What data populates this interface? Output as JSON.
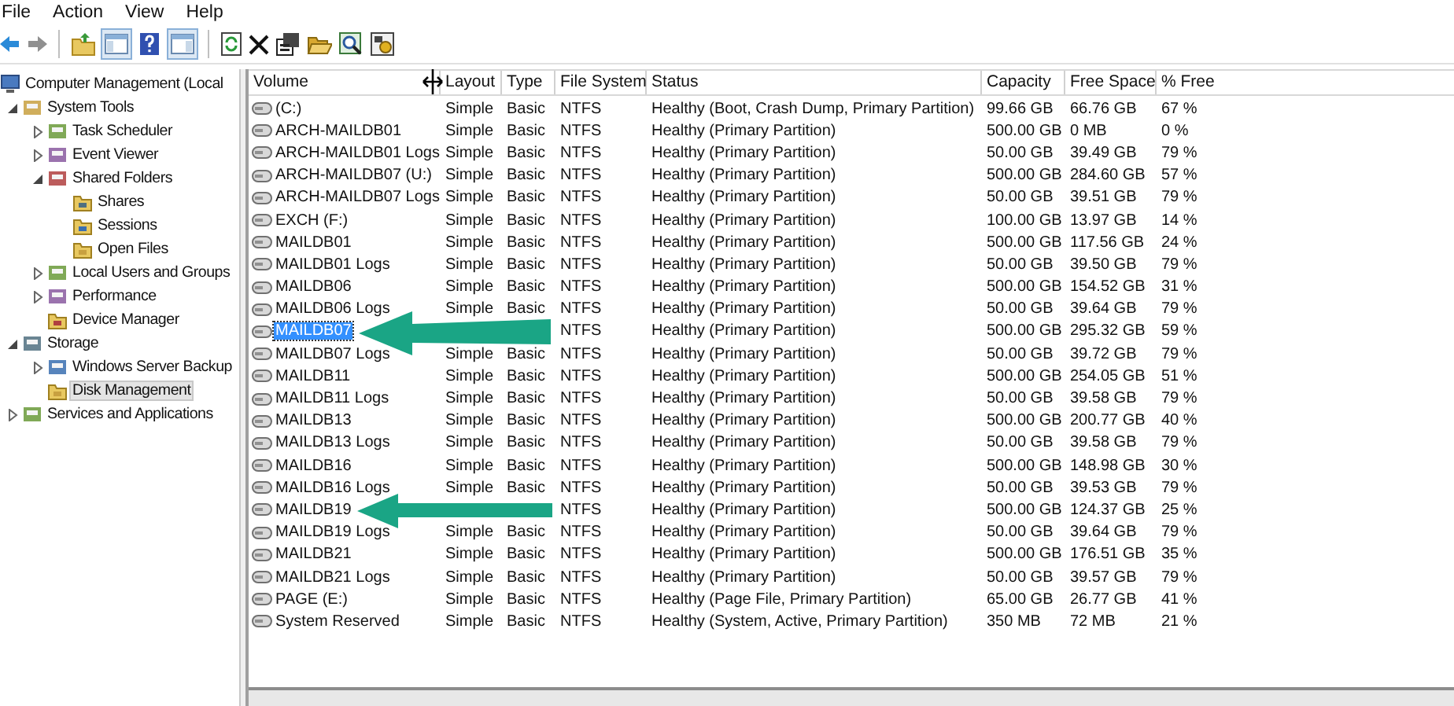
{
  "menu": [
    "File",
    "Action",
    "View",
    "Help"
  ],
  "tree": [
    {
      "label": "Computer Management (Local",
      "kind": "root",
      "selected": false,
      "children": [
        {
          "label": "System Tools",
          "kind": "branch",
          "expanded": true,
          "selected": false,
          "children": [
            {
              "label": "Task Scheduler",
              "kind": "branch",
              "expanded": false,
              "selected": false
            },
            {
              "label": "Event Viewer",
              "kind": "branch",
              "expanded": false,
              "selected": false
            },
            {
              "label": "Shared Folders",
              "kind": "branch",
              "expanded": true,
              "selected": false,
              "children": [
                {
                  "label": "Shares",
                  "kind": "leaf",
                  "selected": false
                },
                {
                  "label": "Sessions",
                  "kind": "leaf",
                  "selected": false
                },
                {
                  "label": "Open Files",
                  "kind": "leaf",
                  "selected": false
                }
              ]
            },
            {
              "label": "Local Users and Groups",
              "kind": "branch",
              "expanded": false,
              "selected": false
            },
            {
              "label": "Performance",
              "kind": "branch",
              "expanded": false,
              "selected": false
            },
            {
              "label": "Device Manager",
              "kind": "leaf",
              "selected": false
            }
          ]
        },
        {
          "label": "Storage",
          "kind": "branch",
          "expanded": true,
          "selected": false,
          "children": [
            {
              "label": "Windows Server Backup",
              "kind": "branch",
              "expanded": false,
              "selected": false
            },
            {
              "label": "Disk Management",
              "kind": "leaf",
              "selected": true
            }
          ]
        },
        {
          "label": "Services and Applications",
          "kind": "branch",
          "expanded": false,
          "selected": false
        }
      ]
    }
  ],
  "table": {
    "columns": [
      "Volume",
      "Layout",
      "Type",
      "File System",
      "Status",
      "Capacity",
      "Free Space",
      "% Free"
    ],
    "rows": [
      {
        "volume": "(C:)",
        "layout": "Simple",
        "type": "Basic",
        "file_system": "NTFS",
        "status": "Healthy (Boot, Crash Dump, Primary Partition)",
        "capacity": "99.66 GB",
        "free_space": "66.76 GB",
        "percent_free": "67 %",
        "selected": false
      },
      {
        "volume": "ARCH-MAILDB01",
        "layout": "Simple",
        "type": "Basic",
        "file_system": "NTFS",
        "status": "Healthy (Primary Partition)",
        "capacity": "500.00 GB",
        "free_space": "0 MB",
        "percent_free": "0 %",
        "selected": false
      },
      {
        "volume": "ARCH-MAILDB01 Logs",
        "layout": "Simple",
        "type": "Basic",
        "file_system": "NTFS",
        "status": "Healthy (Primary Partition)",
        "capacity": "50.00 GB",
        "free_space": "39.49 GB",
        "percent_free": "79 %",
        "selected": false
      },
      {
        "volume": "ARCH-MAILDB07 (U:)",
        "layout": "Simple",
        "type": "Basic",
        "file_system": "NTFS",
        "status": "Healthy (Primary Partition)",
        "capacity": "500.00 GB",
        "free_space": "284.60 GB",
        "percent_free": "57 %",
        "selected": false
      },
      {
        "volume": "ARCH-MAILDB07 Logs",
        "layout": "Simple",
        "type": "Basic",
        "file_system": "NTFS",
        "status": "Healthy (Primary Partition)",
        "capacity": "50.00 GB",
        "free_space": "39.51 GB",
        "percent_free": "79 %",
        "selected": false
      },
      {
        "volume": "EXCH (F:)",
        "layout": "Simple",
        "type": "Basic",
        "file_system": "NTFS",
        "status": "Healthy (Primary Partition)",
        "capacity": "100.00 GB",
        "free_space": "13.97 GB",
        "percent_free": "14 %",
        "selected": false
      },
      {
        "volume": "MAILDB01",
        "layout": "Simple",
        "type": "Basic",
        "file_system": "NTFS",
        "status": "Healthy (Primary Partition)",
        "capacity": "500.00 GB",
        "free_space": "117.56 GB",
        "percent_free": "24 %",
        "selected": false
      },
      {
        "volume": "MAILDB01 Logs",
        "layout": "Simple",
        "type": "Basic",
        "file_system": "NTFS",
        "status": "Healthy (Primary Partition)",
        "capacity": "50.00 GB",
        "free_space": "39.50 GB",
        "percent_free": "79 %",
        "selected": false
      },
      {
        "volume": "MAILDB06",
        "layout": "Simple",
        "type": "Basic",
        "file_system": "NTFS",
        "status": "Healthy (Primary Partition)",
        "capacity": "500.00 GB",
        "free_space": "154.52 GB",
        "percent_free": "31 %",
        "selected": false
      },
      {
        "volume": "MAILDB06 Logs",
        "layout": "Simple",
        "type": "Basic",
        "file_system": "NTFS",
        "status": "Healthy (Primary Partition)",
        "capacity": "50.00 GB",
        "free_space": "39.64 GB",
        "percent_free": "79 %",
        "selected": false
      },
      {
        "volume": "MAILDB07",
        "file_system": "NTFS",
        "status": "Healthy (Primary Partition)",
        "capacity": "500.00 GB",
        "free_space": "295.32 GB",
        "percent_free": "59 %",
        "selected": true
      },
      {
        "volume": "MAILDB07 Logs",
        "layout": "Simple",
        "type": "Basic",
        "file_system": "NTFS",
        "status": "Healthy (Primary Partition)",
        "capacity": "50.00 GB",
        "free_space": "39.72 GB",
        "percent_free": "79 %",
        "selected": false
      },
      {
        "volume": "MAILDB11",
        "layout": "Simple",
        "type": "Basic",
        "file_system": "NTFS",
        "status": "Healthy (Primary Partition)",
        "capacity": "500.00 GB",
        "free_space": "254.05 GB",
        "percent_free": "51 %",
        "selected": false
      },
      {
        "volume": "MAILDB11 Logs",
        "layout": "Simple",
        "type": "Basic",
        "file_system": "NTFS",
        "status": "Healthy (Primary Partition)",
        "capacity": "50.00 GB",
        "free_space": "39.58 GB",
        "percent_free": "79 %",
        "selected": false
      },
      {
        "volume": "MAILDB13",
        "layout": "Simple",
        "type": "Basic",
        "file_system": "NTFS",
        "status": "Healthy (Primary Partition)",
        "capacity": "500.00 GB",
        "free_space": "200.77 GB",
        "percent_free": "40 %",
        "selected": false
      },
      {
        "volume": "MAILDB13 Logs",
        "layout": "Simple",
        "type": "Basic",
        "file_system": "NTFS",
        "status": "Healthy (Primary Partition)",
        "capacity": "50.00 GB",
        "free_space": "39.58 GB",
        "percent_free": "79 %",
        "selected": false
      },
      {
        "volume": "MAILDB16",
        "layout": "Simple",
        "type": "Basic",
        "file_system": "NTFS",
        "status": "Healthy (Primary Partition)",
        "capacity": "500.00 GB",
        "free_space": "148.98 GB",
        "percent_free": "30 %",
        "selected": false
      },
      {
        "volume": "MAILDB16 Logs",
        "layout": "Simple",
        "type": "Basic",
        "file_system": "NTFS",
        "status": "Healthy (Primary Partition)",
        "capacity": "50.00 GB",
        "free_space": "39.53 GB",
        "percent_free": "79 %",
        "selected": false
      },
      {
        "volume": "MAILDB19",
        "file_system": "NTFS",
        "status": "Healthy (Primary Partition)",
        "capacity": "500.00 GB",
        "free_space": "124.37 GB",
        "percent_free": "25 %",
        "selected": false
      },
      {
        "volume": "MAILDB19 Logs",
        "layout": "Simple",
        "type": "Basic",
        "file_system": "NTFS",
        "status": "Healthy (Primary Partition)",
        "capacity": "50.00 GB",
        "free_space": "39.64 GB",
        "percent_free": "79 %",
        "selected": false
      },
      {
        "volume": "MAILDB21",
        "layout": "Simple",
        "type": "Basic",
        "file_system": "NTFS",
        "status": "Healthy (Primary Partition)",
        "capacity": "500.00 GB",
        "free_space": "176.51 GB",
        "percent_free": "35 %",
        "selected": false
      },
      {
        "volume": "MAILDB21 Logs",
        "layout": "Simple",
        "type": "Basic",
        "file_system": "NTFS",
        "status": "Healthy (Primary Partition)",
        "capacity": "50.00 GB",
        "free_space": "39.57 GB",
        "percent_free": "79 %",
        "selected": false
      },
      {
        "volume": "PAGE (E:)",
        "layout": "Simple",
        "type": "Basic",
        "file_system": "NTFS",
        "status": "Healthy (Page File, Primary Partition)",
        "capacity": "65.00 GB",
        "free_space": "26.77 GB",
        "percent_free": "41 %",
        "selected": false
      },
      {
        "volume": "System Reserved",
        "layout": "Simple",
        "type": "Basic",
        "file_system": "NTFS",
        "status": "Healthy (System, Active, Primary Partition)",
        "capacity": "350 MB",
        "free_space": "72 MB",
        "percent_free": "21 %",
        "selected": false
      }
    ]
  }
}
